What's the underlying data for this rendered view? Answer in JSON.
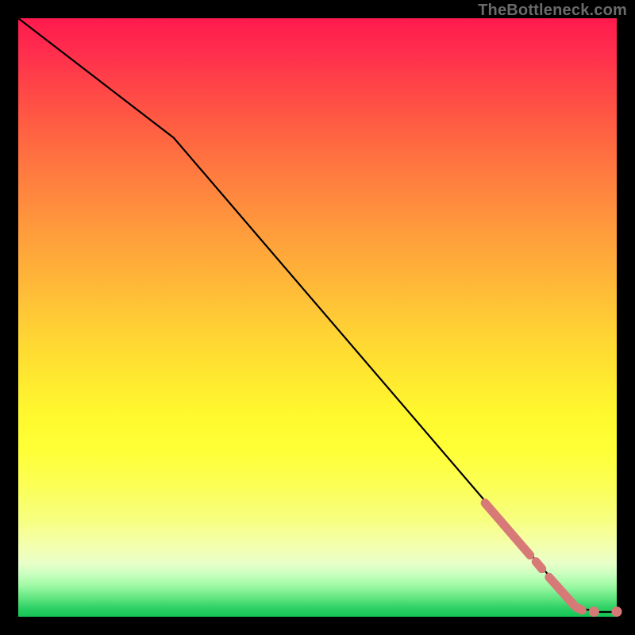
{
  "attribution": "TheBottleneck.com",
  "colors": {
    "line": "#000000",
    "marker_fill": "#d77a77",
    "marker_stroke": "#b85a57",
    "plot_bg_top": "#ff1a4d",
    "plot_bg_bottom": "#14c454",
    "page_bg": "#000000"
  },
  "chart_data": {
    "type": "line",
    "title": "",
    "xlabel": "",
    "ylabel": "",
    "xlim": [
      0,
      100
    ],
    "ylim": [
      0,
      100
    ],
    "grid": false,
    "legend": false,
    "line_points": [
      {
        "x": 0,
        "y": 100
      },
      {
        "x": 26,
        "y": 80
      },
      {
        "x": 92,
        "y": 3
      },
      {
        "x": 94,
        "y": 1.4
      },
      {
        "x": 97,
        "y": 0.8
      },
      {
        "x": 100,
        "y": 0.8
      }
    ],
    "marker_segments": [
      {
        "x1": 78.0,
        "y1": 19.0,
        "x2": 85.5,
        "y2": 10.3,
        "width": 11
      },
      {
        "x1": 86.5,
        "y1": 9.2,
        "x2": 87.5,
        "y2": 8.0,
        "width": 11
      },
      {
        "x1": 88.7,
        "y1": 6.6,
        "x2": 92.8,
        "y2": 2.0,
        "width": 11
      },
      {
        "x1": 93.2,
        "y1": 1.6,
        "x2": 94.2,
        "y2": 1.1,
        "width": 11
      }
    ],
    "marker_dots": [
      {
        "x": 96.2,
        "y": 0.85,
        "r": 6.5
      },
      {
        "x": 100.0,
        "y": 0.85,
        "r": 6.5
      }
    ]
  }
}
